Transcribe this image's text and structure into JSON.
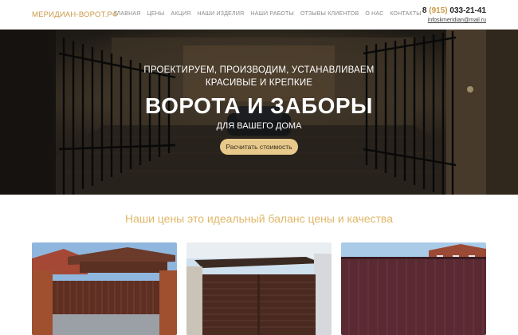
{
  "header": {
    "logo": "МЕРИДИАН-ВОРОТ.РФ",
    "nav": [
      "ГЛАВНАЯ",
      "ЦЕНЫ",
      "АКЦИЯ",
      "НАШИ ИЗДЕЛИЯ",
      "НАШИ РАБОТЫ",
      "ОТЗЫВЫ КЛИЕНТОВ",
      "О НАС",
      "КОНТАКТЫ"
    ],
    "phone_prefix": "8",
    "phone_code": "(915)",
    "phone_number": "033-21-41",
    "email": "infoskmeridian@mail.ru"
  },
  "hero": {
    "line1": "ПРОЕКТИРУЕМ, ПРОИЗВОДИМ, УСТАНАВЛИВАЕМ",
    "line2": "КРАСИВЫЕ И КРЕПКИЕ",
    "title": "ВОРОТА И ЗАБОРЫ",
    "line3": "ДЛЯ ВАШЕГО ДОМА",
    "cta": "Расчитать стоимость"
  },
  "prices": {
    "title": "Наши цены это идеальный баланс цены и качества"
  },
  "colors": {
    "accent": "#c99a4a",
    "button": "#e7c98c",
    "section_title": "#e0b768"
  }
}
